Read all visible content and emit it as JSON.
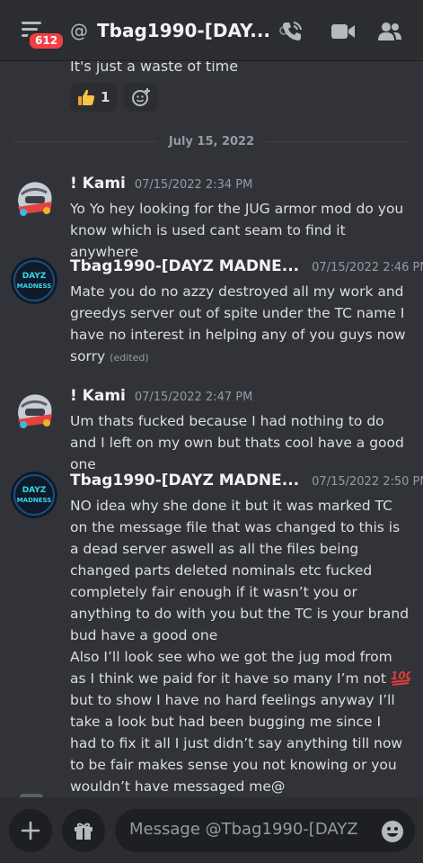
{
  "header": {
    "unread_badge": "612",
    "at_symbol": "@",
    "title": "Tbag1990-[DAY...",
    "icons": [
      "menu-icon",
      "phone-call-icon",
      "video-call-icon",
      "members-icon"
    ]
  },
  "previous": {
    "cut_text": "It's just a waste of time",
    "reactions": [
      {
        "emoji": "thumbs-up",
        "count": "1"
      }
    ],
    "add_reaction_icon": "add-reaction-icon"
  },
  "date_divider": "July 15, 2022",
  "messages": [
    {
      "author": "! Kami",
      "time": "07/15/2022 2:34 PM",
      "text": "Yo Yo hey looking for the JUG armor mod do you know which is used cant seam to find it anywhere"
    },
    {
      "author": "Tbag1990-[DAYZ MADNE...",
      "time": "07/15/2022 2:46 PM",
      "text": "Mate you do no azzy destroyed all my work and greedys server out of spite under the TC name I have no interest in helping any of you guys now sorry",
      "edited": "(edited)",
      "avatar_text": "DAYZ MADNESS"
    },
    {
      "author": "! Kami",
      "time": "07/15/2022 2:47 PM",
      "text": "Um thats fucked because I had nothing to do and I left on my own but thats cool have a good one"
    },
    {
      "author": "Tbag1990-[DAYZ MADNE...",
      "time": "07/15/2022 2:50 PM",
      "text_part1": "NO idea why she done it but it was marked TC on the message file that was changed to this is a dead server aswell as all the files being changed parts deleted nominals etc fucked completely fair enough if it wasn’t you or anything to do with you but the TC is your brand bud have a good one",
      "text_part2a": "Also I’ll look see who we got the jug mod from as I think we paid for it have so many I’m not",
      "text_part2b": " but to show I have no hard feelings anyway I’ll take a look but had been bugging me since I had to fix it all I just didn’t say anything till now to be fair makes sense you not knowing or you wouldn’t have messaged me@",
      "avatar_text": "DAYZ MADNESS"
    }
  ],
  "composer": {
    "placeholder": "Message @Tbag1990-[DAYZ ...",
    "icons": [
      "plus-icon",
      "gift-icon",
      "emoji-icon"
    ]
  },
  "colors": {
    "background": "#313338",
    "header": "#2b2d31",
    "input": "#1e1f22",
    "badge": "#f23f43",
    "text": "#dbdee1",
    "muted": "#949ba4"
  }
}
